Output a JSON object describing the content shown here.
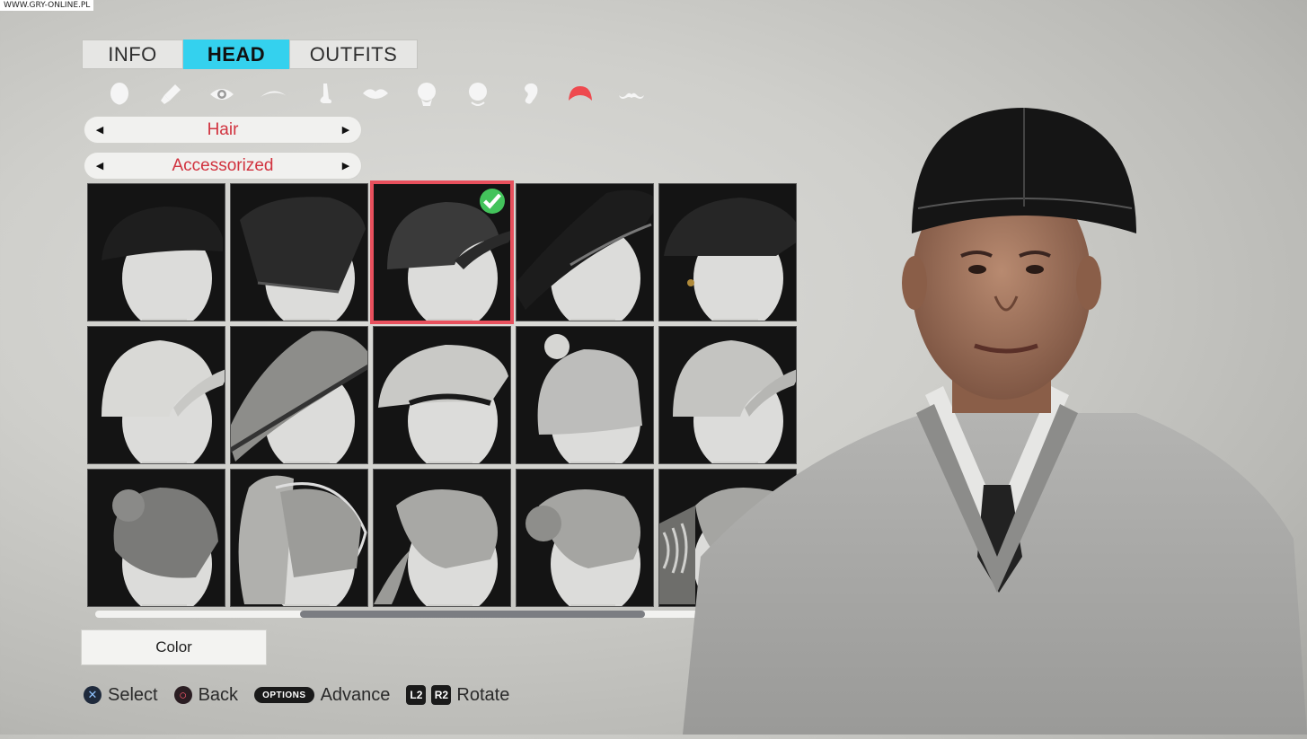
{
  "watermark": "WWW.GRY-ONLINE.PL",
  "tabs": [
    {
      "label": "INFO"
    },
    {
      "label": "HEAD",
      "active": true
    },
    {
      "label": "OUTFITS"
    }
  ],
  "category_icons": [
    "head-shape-icon",
    "skin-brush-icon",
    "eye-icon",
    "eyebrow-icon",
    "nose-icon",
    "lips-icon",
    "ear-left-icon",
    "chin-icon",
    "ear-icon",
    "hair-icon",
    "mustache-icon"
  ],
  "selectors": {
    "category": {
      "value": "Hair"
    },
    "style": {
      "value": "Accessorized"
    }
  },
  "grid": {
    "selected_index": 2,
    "items": [
      {
        "icon": "newsboy-cap-icon"
      },
      {
        "icon": "beanie-icon"
      },
      {
        "icon": "baseball-cap-icon"
      },
      {
        "icon": "wide-brim-hat-icon"
      },
      {
        "icon": "fisherman-cap-icon"
      },
      {
        "icon": "white-baseball-cap-icon"
      },
      {
        "icon": "fedora-long-hair-icon"
      },
      {
        "icon": "flat-cap-icon"
      },
      {
        "icon": "pom-beanie-icon"
      },
      {
        "icon": "grey-baseball-cap-icon"
      },
      {
        "icon": "top-bun-icon"
      },
      {
        "icon": "high-ponytail-headband-icon"
      },
      {
        "icon": "low-ponytail-headband-icon"
      },
      {
        "icon": "low-bun-icon"
      },
      {
        "icon": "dread-ponytail-icon"
      }
    ]
  },
  "scroll": {
    "position": 0.36
  },
  "color_button": {
    "label": "Color"
  },
  "hints": [
    {
      "button": "✕",
      "label": "Select"
    },
    {
      "button": "○",
      "label": "Back"
    },
    {
      "button": "OPTIONS",
      "label": "Advance"
    },
    {
      "button": "L2",
      "button2": "R2",
      "label": "Rotate"
    }
  ],
  "colors": {
    "accent": "#34d1ee",
    "selected": "#e8505d",
    "selector_text": "#d1333f",
    "check": "#43c35b"
  }
}
